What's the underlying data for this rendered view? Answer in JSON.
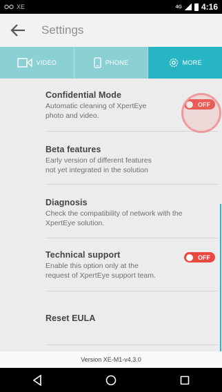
{
  "status_bar": {
    "left_text": "XE",
    "network": "4G",
    "time": "4:16"
  },
  "app_bar": {
    "title": "Settings",
    "back_icon": "arrow-left-icon"
  },
  "tabs": [
    {
      "label": "VIDEO",
      "icon": "video-camera-icon",
      "active": false
    },
    {
      "label": "PHONE",
      "icon": "phone-icon",
      "active": false
    },
    {
      "label": "MORE",
      "icon": "gear-icon",
      "active": true
    }
  ],
  "settings": [
    {
      "title": "Confidential Mode",
      "description": "Automatic cleaning of XpertEye\nphoto and video.",
      "toggle": "OFF"
    },
    {
      "title": "Beta features",
      "description": "Early version of different features\nnot yet integrated in the solution"
    },
    {
      "title": "Diagnosis",
      "description": "Check the compatibility of network with the\nXpertEye solution."
    },
    {
      "title": "Technical support",
      "description": "Enable this option only at the\nrequest of XpertEye support team.",
      "toggle": "OFF"
    },
    {
      "title": "Reset EULA",
      "description": ""
    }
  ],
  "footer": {
    "version": "Version XE-M1-v4.3.0"
  },
  "colors": {
    "tab_bar": "#8bd0d3",
    "tab_active": "#27b5c4",
    "toggle_off": "#e9473f",
    "highlight_ring": "#ef9a9a"
  },
  "nav_bar": [
    "back-triangle-icon",
    "home-circle-icon",
    "recents-square-icon"
  ]
}
